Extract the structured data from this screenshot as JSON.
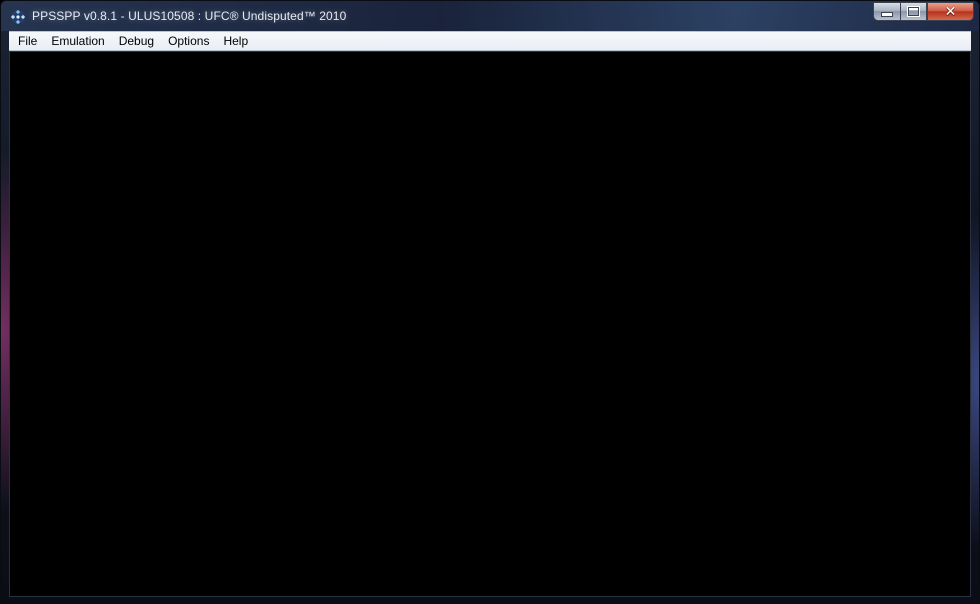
{
  "window": {
    "title": "PPSSPP v0.8.1 - ULUS10508 : UFC® Undisputed™ 2010",
    "icon": "ppsspp-app-icon"
  },
  "menubar": {
    "items": [
      {
        "label": "File"
      },
      {
        "label": "Emulation"
      },
      {
        "label": "Debug"
      },
      {
        "label": "Options"
      },
      {
        "label": "Help"
      }
    ]
  },
  "caption_buttons": {
    "minimize_icon": "minimize-icon",
    "maximize_icon": "maximize-icon",
    "close_icon": "close-icon"
  },
  "colors": {
    "client_background": "#000000",
    "menubar_background": "#f0f3f8",
    "close_button": "#c8452e"
  }
}
